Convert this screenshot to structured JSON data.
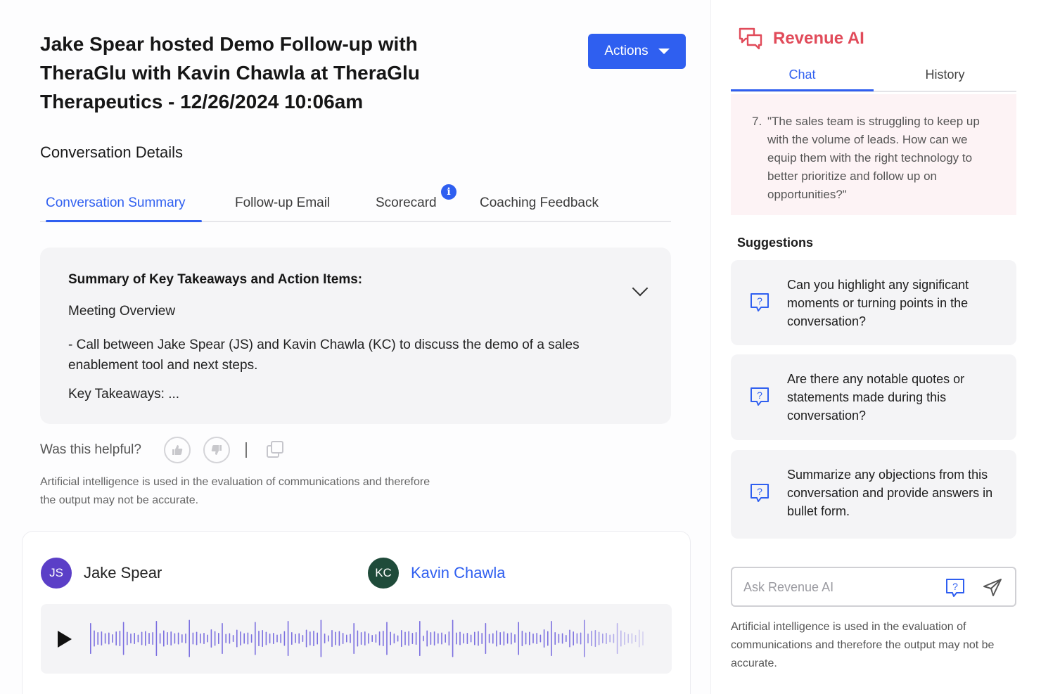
{
  "header": {
    "title": "Jake Spear hosted Demo Follow-up with TheraGlu with Kavin Chawla at TheraGlu Therapeutics - 12/26/2024 10:06am",
    "actions_label": "Actions"
  },
  "details": {
    "heading": "Conversation Details",
    "tabs": [
      {
        "label": "Conversation Summary",
        "active": true
      },
      {
        "label": "Follow-up Email",
        "active": false
      },
      {
        "label": "Scorecard",
        "active": false
      },
      {
        "label": "Coaching Feedback",
        "active": false
      }
    ],
    "info_badge": "i"
  },
  "summary": {
    "heading": "Summary of Key Takeaways and Action Items:",
    "overview_label": "Meeting Overview",
    "overview_text": "- Call between Jake Spear (JS) and Kavin Chawla (KC) to discuss the demo of a sales enablement tool and next steps.",
    "key_takeaways": "Key Takeaways: ..."
  },
  "feedback": {
    "label": "Was this helpful?",
    "disclaimer": "Artificial intelligence is used in the evaluation of communications and therefore the output may not be accurate."
  },
  "participants": [
    {
      "initials": "JS",
      "name": "Jake Spear",
      "color": "#5b3fc7"
    },
    {
      "initials": "KC",
      "name": "Kavin Chawla",
      "color": "#1f4b3a"
    }
  ],
  "revenue_ai": {
    "title": "Revenue AI",
    "accent": "#e14b5a",
    "tabs": [
      {
        "label": "Chat",
        "active": true
      },
      {
        "label": "History",
        "active": false
      }
    ],
    "message": {
      "number": "7.",
      "text": "\"The sales team is struggling to keep up with the volume of leads. How can we equip them with the right technology to better prioritize and follow up on opportunities?\""
    },
    "suggestions_heading": "Suggestions",
    "suggestions": [
      "Can you highlight any significant moments or turning points in the conversation?",
      "Are there any notable quotes or statements made during this conversation?",
      "Summarize any objections from this conversation and provide answers in bullet form."
    ],
    "input_placeholder": "Ask Revenue AI",
    "disclaimer": "Artificial intelligence is used in the evaluation of communications and therefore the output may not be accurate."
  },
  "colors": {
    "primary": "#2f5ff0",
    "waveform": "#7b6fe0"
  }
}
